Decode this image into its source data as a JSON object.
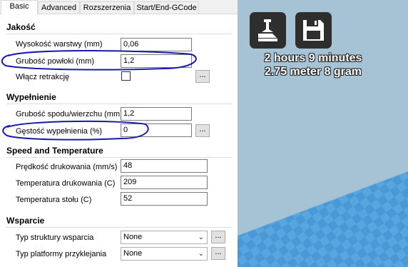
{
  "tabs": [
    "Basic",
    "Advanced",
    "Rozszerzenia",
    "Start/End-GCode"
  ],
  "sections": {
    "quality": {
      "title": "Jakość",
      "layer_height": {
        "label": "Wysokość warstwy (mm)",
        "value": "0,06"
      },
      "shell_thickness": {
        "label": "Grubość powłoki (mm)",
        "value": "1,2"
      },
      "retraction": {
        "label": "Włącz retrakcję",
        "checked": false
      }
    },
    "fill": {
      "title": "Wypełnienie",
      "bottom_top": {
        "label": "Grubość spodu/wierzchu (mm)",
        "value": "1,2"
      },
      "fill_density": {
        "label": "Gęstość wypełnienia (%)",
        "value": "0"
      }
    },
    "speed": {
      "title": "Speed and Temperature",
      "print_speed": {
        "label": "Prędkość drukowania (mm/s)",
        "value": "48"
      },
      "print_temp": {
        "label": "Temperatura drukowania (C)",
        "value": "209"
      },
      "bed_temp": {
        "label": "Temperatura stołu (C)",
        "value": "52"
      }
    },
    "support": {
      "title": "Wsparcie",
      "support_type": {
        "label": "Typ struktury wsparcia",
        "value": "None"
      },
      "adhesion_type": {
        "label": "Typ platformy przyklejania",
        "value": "None"
      }
    }
  },
  "dots_label": "...",
  "viewer": {
    "print_time": "2 hours 9 minutes",
    "material": "2.75 meter 8 gram",
    "icons": [
      "load-model-icon",
      "save-icon"
    ],
    "background_color": "#a5c3d5",
    "platform_color": "#4a98d6"
  }
}
